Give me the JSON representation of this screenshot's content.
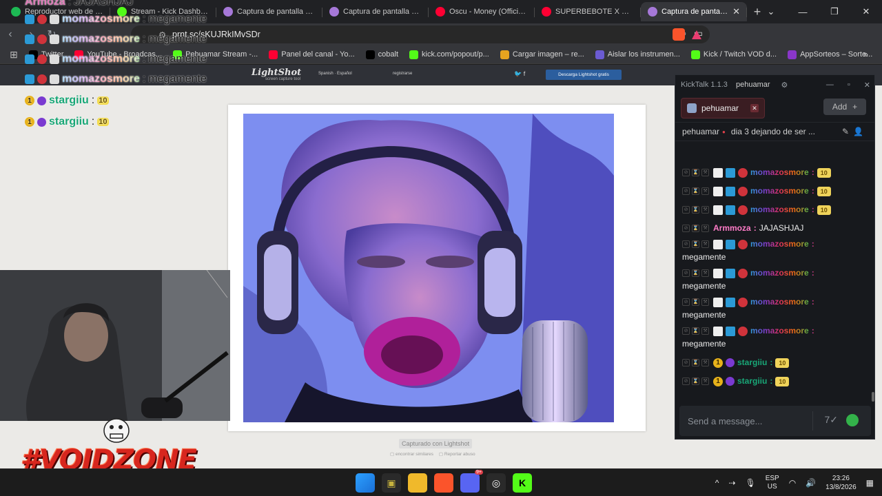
{
  "tabs": [
    {
      "label": "Reproductor web de Spot",
      "color": "#1db954",
      "active": false
    },
    {
      "label": "Stream - Kick Dashboard",
      "color": "#53fc18",
      "active": false
    },
    {
      "label": "Captura de pantalla por L",
      "color": "#a678d8",
      "active": false
    },
    {
      "label": "Captura de pantalla por L",
      "color": "#a678d8",
      "active": false
    },
    {
      "label": "Oscu - Money (Official Vi",
      "color": "#ff0033",
      "active": false
    },
    {
      "label": "SUPERBEBOTE X EN UN P",
      "color": "#ff0033",
      "active": false
    },
    {
      "label": "Captura de pantalla p",
      "color": "#a678d8",
      "active": true
    }
  ],
  "url": "prnt.sc/sKUJRkIMvSDr",
  "bookmarks": [
    {
      "label": "Twitter",
      "color": "#000000"
    },
    {
      "label": "YouTube - Broadcas...",
      "color": "#ff0033"
    },
    {
      "label": "Pehuamar Stream -...",
      "color": "#53fc18"
    },
    {
      "label": "Panel del canal - Yo...",
      "color": "#ff0033"
    },
    {
      "label": "cobalt",
      "color": "#000000"
    },
    {
      "label": "kick.com/popout/p...",
      "color": "#53fc18"
    },
    {
      "label": "Cargar imagen – re...",
      "color": "#e7a41f"
    },
    {
      "label": "Aislar los instrumen...",
      "color": "#6b5bd2"
    },
    {
      "label": "Kick / Twitch VOD d...",
      "color": "#53fc18"
    },
    {
      "label": "AppSorteos – Sorte...",
      "color": "#8a36c9"
    }
  ],
  "lightshot": {
    "logo": "LightShot",
    "tagline": "screen capture tool",
    "lang": "Spanish · Español",
    "register": "registrarse",
    "download": "Descarga Lightshot gratis",
    "captured": "Capturado con Lightshot",
    "similar": "encontrar similares",
    "report": "Reportar abuso"
  },
  "overlay": {
    "top_name": "Armoza",
    "top_msg": "JAJASHJAJ",
    "lines": [
      {
        "name": "momazosmore",
        "msg": "megamente"
      },
      {
        "name": "momazosmore",
        "msg": "megamente"
      },
      {
        "name": "momazosmore",
        "msg": "megamente"
      },
      {
        "name": "momazosmore",
        "msg": "megamente"
      }
    ],
    "stargiiu": [
      {
        "name": "stargiiu"
      },
      {
        "name": "stargiiu"
      }
    ],
    "badge_number": "1",
    "brand": "#VOIDZONE"
  },
  "kicktalk": {
    "app": "KickTalk 1.1.3",
    "user": "pehuamar",
    "channel_tab": "pehuamar",
    "add_label": "Add",
    "stream_name": "pehuamar",
    "stream_title": "dia 3 dejando de ser ...",
    "input_placeholder": "Send a message...",
    "messages": [
      {
        "name": "momazosmore",
        "text": "",
        "emote": true,
        "style": "rainbow",
        "badges": 3,
        "wrap": false
      },
      {
        "name": "momazosmore",
        "text": "",
        "emote": true,
        "style": "rainbow",
        "badges": 3,
        "wrap": false
      },
      {
        "name": "momazosmore",
        "text": "",
        "emote": true,
        "style": "rainbow",
        "badges": 3,
        "wrap": false
      },
      {
        "name": "Armmoza",
        "text": "JAJASHJAJ",
        "emote": false,
        "style": "pink",
        "badges": 0,
        "wrap": false
      },
      {
        "name": "momazosmore",
        "text": "megamente",
        "emote": false,
        "style": "rainbow",
        "badges": 3,
        "wrap": true
      },
      {
        "name": "momazosmore",
        "text": "megamente",
        "emote": false,
        "style": "rainbow",
        "badges": 3,
        "wrap": true
      },
      {
        "name": "momazosmore",
        "text": "megamente",
        "emote": false,
        "style": "rainbow",
        "badges": 3,
        "wrap": true
      },
      {
        "name": "momazosmore",
        "text": "megamente",
        "emote": false,
        "style": "rainbow",
        "badges": 3,
        "wrap": true
      },
      {
        "name": "stargiiu",
        "text": "",
        "emote": true,
        "style": "green",
        "badges": 2,
        "wrap": false
      },
      {
        "name": "stargiiu",
        "text": "",
        "emote": true,
        "style": "green",
        "badges": 2,
        "wrap": false
      }
    ]
  },
  "taskbar": {
    "lang_top": "ESP",
    "lang_bottom": "US",
    "time": "23:26",
    "date": "13/8/2026",
    "discord_badge": "9+"
  }
}
